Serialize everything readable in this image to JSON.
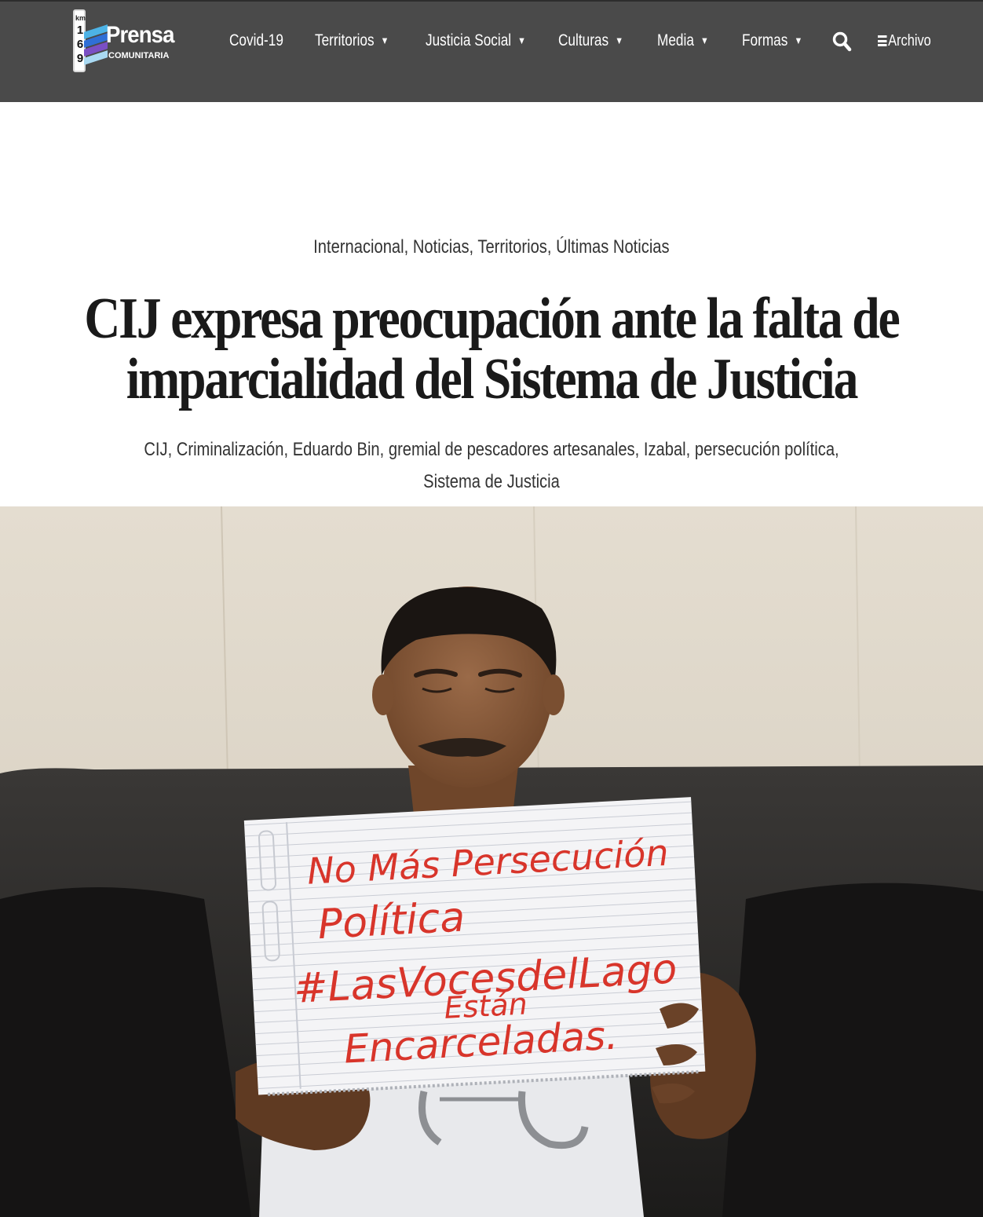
{
  "site": {
    "logo": {
      "km": "km",
      "digits": [
        "1",
        "6",
        "9"
      ],
      "name": "Prensa",
      "subtitle": "COMUNITARIA"
    }
  },
  "nav": {
    "items": [
      {
        "label": "Covid-19",
        "dropdown": false
      },
      {
        "label": "Territorios",
        "dropdown": true
      },
      {
        "label": "Justicia Social",
        "dropdown": true
      },
      {
        "label": "Culturas",
        "dropdown": true
      },
      {
        "label": "Media",
        "dropdown": true
      },
      {
        "label": "Formas",
        "dropdown": true
      }
    ],
    "caret": "▼",
    "search_icon": "search-icon",
    "archive_label": "Archivo",
    "archive_icon": "hamburger-icon"
  },
  "article": {
    "categories": [
      "Internacional",
      "Noticias",
      "Territorios",
      "Últimas Noticias"
    ],
    "title_lines": [
      "CIJ expresa preocupación ante la falta de",
      "imparcialidad del Sistema de Justicia"
    ],
    "tags_line1": [
      "CIJ",
      "Criminalización",
      "Eduardo Bin",
      "gremial de pescadores artesanales",
      "Izabal",
      "persecución política"
    ],
    "tags_line2": [
      "Sistema de Justicia"
    ],
    "featured_image": {
      "description_name": "featured-photo",
      "sign_lines": [
        "No Más Persecución",
        "Política",
        "#LasVocesdelLago",
        "Están",
        "Encarceladas."
      ]
    }
  },
  "colors": {
    "header_bg": "#4a4a4a",
    "header_text": "#ffffff",
    "title_text": "#1a1a1a",
    "sign_ink": "#d8352b"
  }
}
